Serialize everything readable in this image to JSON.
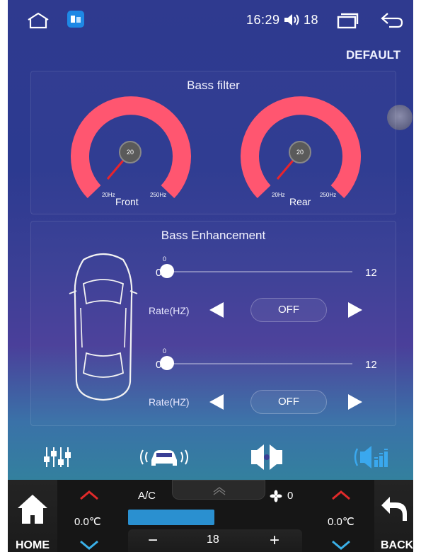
{
  "status": {
    "time": "16:29",
    "volume": "18"
  },
  "header": {
    "default_label": "DEFAULT"
  },
  "bass_filter": {
    "title": "Bass filter",
    "front": {
      "label": "Front",
      "value": "20",
      "min": "20Hz",
      "max": "250Hz"
    },
    "rear": {
      "label": "Rear",
      "value": "20",
      "min": "20Hz",
      "max": "250Hz"
    }
  },
  "bass_enhancement": {
    "title": "Bass Enhancement",
    "front": {
      "value": "0",
      "min": "0",
      "max": "12",
      "rate_label": "Rate(HZ)",
      "rate_value": "OFF"
    },
    "rear": {
      "value": "0",
      "min": "0",
      "max": "12",
      "rate_label": "Rate(HZ)",
      "rate_value": "OFF"
    }
  },
  "tabs": [
    "equalizer-icon",
    "car-surround-icon",
    "balance-icon",
    "bass-speaker-icon"
  ],
  "climate": {
    "home_label": "HOME",
    "back_label": "BACK",
    "ac_label": "A/C",
    "fan_value": "0",
    "left_temp": "0.0℃",
    "right_temp": "0.0℃",
    "fan_speed": "18",
    "minus_label": "−",
    "plus_label": "+"
  },
  "colors": {
    "gauge": "#ff5670",
    "needle": "#e8242b",
    "accent_blue": "#3aa0e0",
    "chevron_up": "#e02a2a",
    "chevron_down": "#3ab0e8"
  }
}
